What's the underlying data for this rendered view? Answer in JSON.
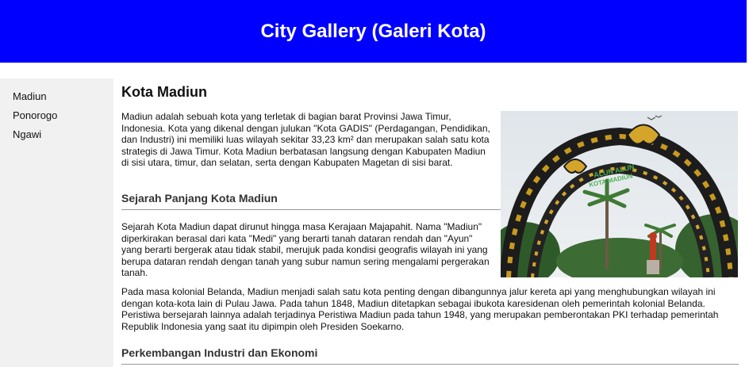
{
  "header": {
    "title": "City Gallery (Galeri Kota)"
  },
  "sidebar": {
    "items": [
      {
        "label": "Madiun"
      },
      {
        "label": "Ponorogo"
      },
      {
        "label": "Ngawi"
      }
    ]
  },
  "main": {
    "title": "Kota Madiun",
    "intro": "Madiun adalah sebuah kota yang terletak di bagian barat Provinsi Jawa Timur, Indonesia. Kota yang dikenal dengan julukan \"Kota GADIS\" (Perdagangan, Pendidikan, dan Industri) ini memiliki luas wilayah sekitar 33,23 km² dan merupakan salah satu kota strategis di Jawa Timur. Kota Madiun berbatasan langsung dengan Kabupaten Madiun di sisi utara, timur, dan selatan, serta dengan Kabupaten Magetan di sisi barat.",
    "section1_title": "Sejarah Panjang Kota Madiun",
    "history_p1": "Sejarah Kota Madiun dapat dirunut hingga masa Kerajaan Majapahit. Nama \"Madiun\" diperkirakan berasal dari kata \"Medi\" yang berarti tanah dataran rendah dan \"Ayun\" yang berarti bergerak atau tidak stabil, merujuk pada kondisi geografis wilayah ini yang berupa dataran rendah dengan tanah yang subur namun sering mengalami pergerakan tanah.",
    "history_p2": "Pada masa kolonial Belanda, Madiun menjadi salah satu kota penting dengan dibangunnya jalur kereta api yang menghubungkan wilayah ini dengan kota-kota lain di Pulau Jawa. Pada tahun 1848, Madiun ditetapkan sebagai ibukota karesidenan oleh pemerintah kolonial Belanda. Peristiwa bersejarah lainnya adalah terjadinya Peristiwa Madiun pada tahun 1948, yang merupakan pemberontakan PKI terhadap pemerintah Republik Indonesia yang saat itu dipimpin oleh Presiden Soekarno.",
    "section2_title": "Perkembangan Industri dan Ekonomi",
    "photo": {
      "arch_text_line1": "ALUN ALUN",
      "arch_text_line2": "KOTA MADIUN"
    }
  }
}
